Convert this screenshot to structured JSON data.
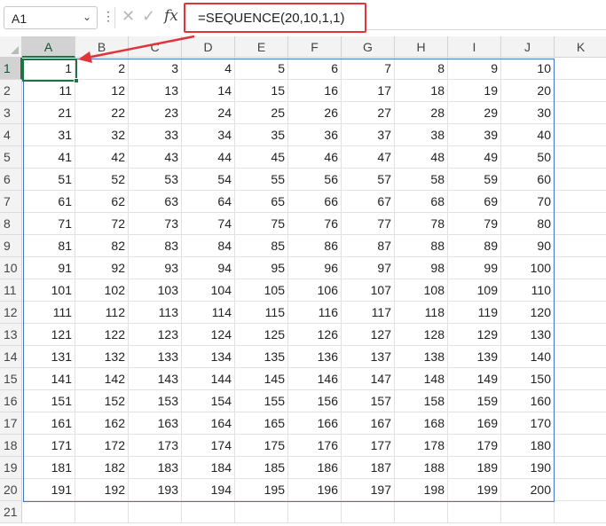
{
  "name_box": {
    "value": "A1"
  },
  "formula_bar": {
    "formula": "=SEQUENCE(20,10,1,1)",
    "fx_label": "fx"
  },
  "columns": [
    "A",
    "B",
    "C",
    "D",
    "E",
    "F",
    "G",
    "H",
    "I",
    "J",
    "K"
  ],
  "rows": [
    "1",
    "2",
    "3",
    "4",
    "5",
    "6",
    "7",
    "8",
    "9",
    "10",
    "11",
    "12",
    "13",
    "14",
    "15",
    "16",
    "17",
    "18",
    "19",
    "20",
    "21"
  ],
  "cells": [
    [
      "1",
      "2",
      "3",
      "4",
      "5",
      "6",
      "7",
      "8",
      "9",
      "10"
    ],
    [
      "11",
      "12",
      "13",
      "14",
      "15",
      "16",
      "17",
      "18",
      "19",
      "20"
    ],
    [
      "21",
      "22",
      "23",
      "24",
      "25",
      "26",
      "27",
      "28",
      "29",
      "30"
    ],
    [
      "31",
      "32",
      "33",
      "34",
      "35",
      "36",
      "37",
      "38",
      "39",
      "40"
    ],
    [
      "41",
      "42",
      "43",
      "44",
      "45",
      "46",
      "47",
      "48",
      "49",
      "50"
    ],
    [
      "51",
      "52",
      "53",
      "54",
      "55",
      "56",
      "57",
      "58",
      "59",
      "60"
    ],
    [
      "61",
      "62",
      "63",
      "64",
      "65",
      "66",
      "67",
      "68",
      "69",
      "70"
    ],
    [
      "71",
      "72",
      "73",
      "74",
      "75",
      "76",
      "77",
      "78",
      "79",
      "80"
    ],
    [
      "81",
      "82",
      "83",
      "84",
      "85",
      "86",
      "87",
      "88",
      "89",
      "90"
    ],
    [
      "91",
      "92",
      "93",
      "94",
      "95",
      "96",
      "97",
      "98",
      "99",
      "100"
    ],
    [
      "101",
      "102",
      "103",
      "104",
      "105",
      "106",
      "107",
      "108",
      "109",
      "110"
    ],
    [
      "111",
      "112",
      "113",
      "114",
      "115",
      "116",
      "117",
      "118",
      "119",
      "120"
    ],
    [
      "121",
      "122",
      "123",
      "124",
      "125",
      "126",
      "127",
      "128",
      "129",
      "130"
    ],
    [
      "131",
      "132",
      "133",
      "134",
      "135",
      "136",
      "137",
      "138",
      "139",
      "140"
    ],
    [
      "141",
      "142",
      "143",
      "144",
      "145",
      "146",
      "147",
      "148",
      "149",
      "150"
    ],
    [
      "151",
      "152",
      "153",
      "154",
      "155",
      "156",
      "157",
      "158",
      "159",
      "160"
    ],
    [
      "161",
      "162",
      "163",
      "164",
      "165",
      "166",
      "167",
      "168",
      "169",
      "170"
    ],
    [
      "171",
      "172",
      "173",
      "174",
      "175",
      "176",
      "177",
      "178",
      "179",
      "180"
    ],
    [
      "181",
      "182",
      "183",
      "184",
      "185",
      "186",
      "187",
      "188",
      "189",
      "190"
    ],
    [
      "191",
      "192",
      "193",
      "194",
      "195",
      "196",
      "197",
      "198",
      "199",
      "200"
    ]
  ],
  "colors": {
    "accent": "#217346",
    "callout": "#e0343a",
    "spill_border": "#4472c4"
  }
}
